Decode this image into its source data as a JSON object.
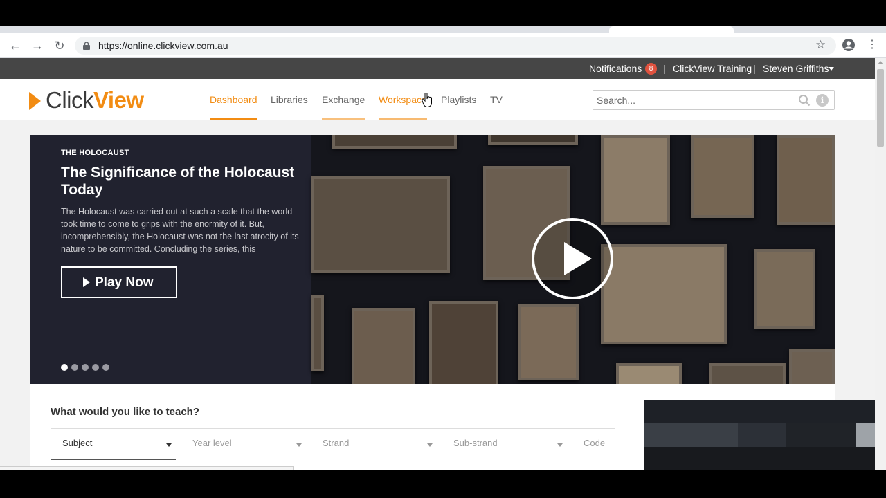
{
  "browser": {
    "url": "https://online.clickview.com.au"
  },
  "topbar": {
    "notifications_label": "Notifications",
    "notifications_count": "8",
    "separator": "|",
    "training_label": "ClickView Training",
    "user_name": "Steven Griffiths"
  },
  "header": {
    "logo_click": "Click",
    "logo_view": "View",
    "nav": {
      "dashboard": "Dashboard",
      "libraries": "Libraries",
      "exchange": "Exchange",
      "workspace": "Workspace",
      "playlists": "Playlists",
      "tv": "TV"
    },
    "search_placeholder": "Search...",
    "info_glyph": "i"
  },
  "hero": {
    "eyebrow": "THE HOLOCAUST",
    "title": "The Significance of the Holocaust Today",
    "description": "The Holocaust was carried out at such a scale that the world took time to come to grips with the enormity of it. But, incomprehensibly, the Holocaust was not the last atrocity of its nature to be committed. Concluding the series, this",
    "play_label": "Play Now",
    "slide_count": 5,
    "active_slide": 1
  },
  "teach": {
    "title": "What would you like to teach?",
    "filters": {
      "subject": "Subject",
      "year_level": "Year level",
      "strand": "Strand",
      "sub_strand": "Sub-strand",
      "code": "Code"
    }
  },
  "colors": {
    "accent": "#f28c13",
    "topbar": "#464646",
    "hero_panel": "#21222f",
    "badge": "#e0523f"
  }
}
